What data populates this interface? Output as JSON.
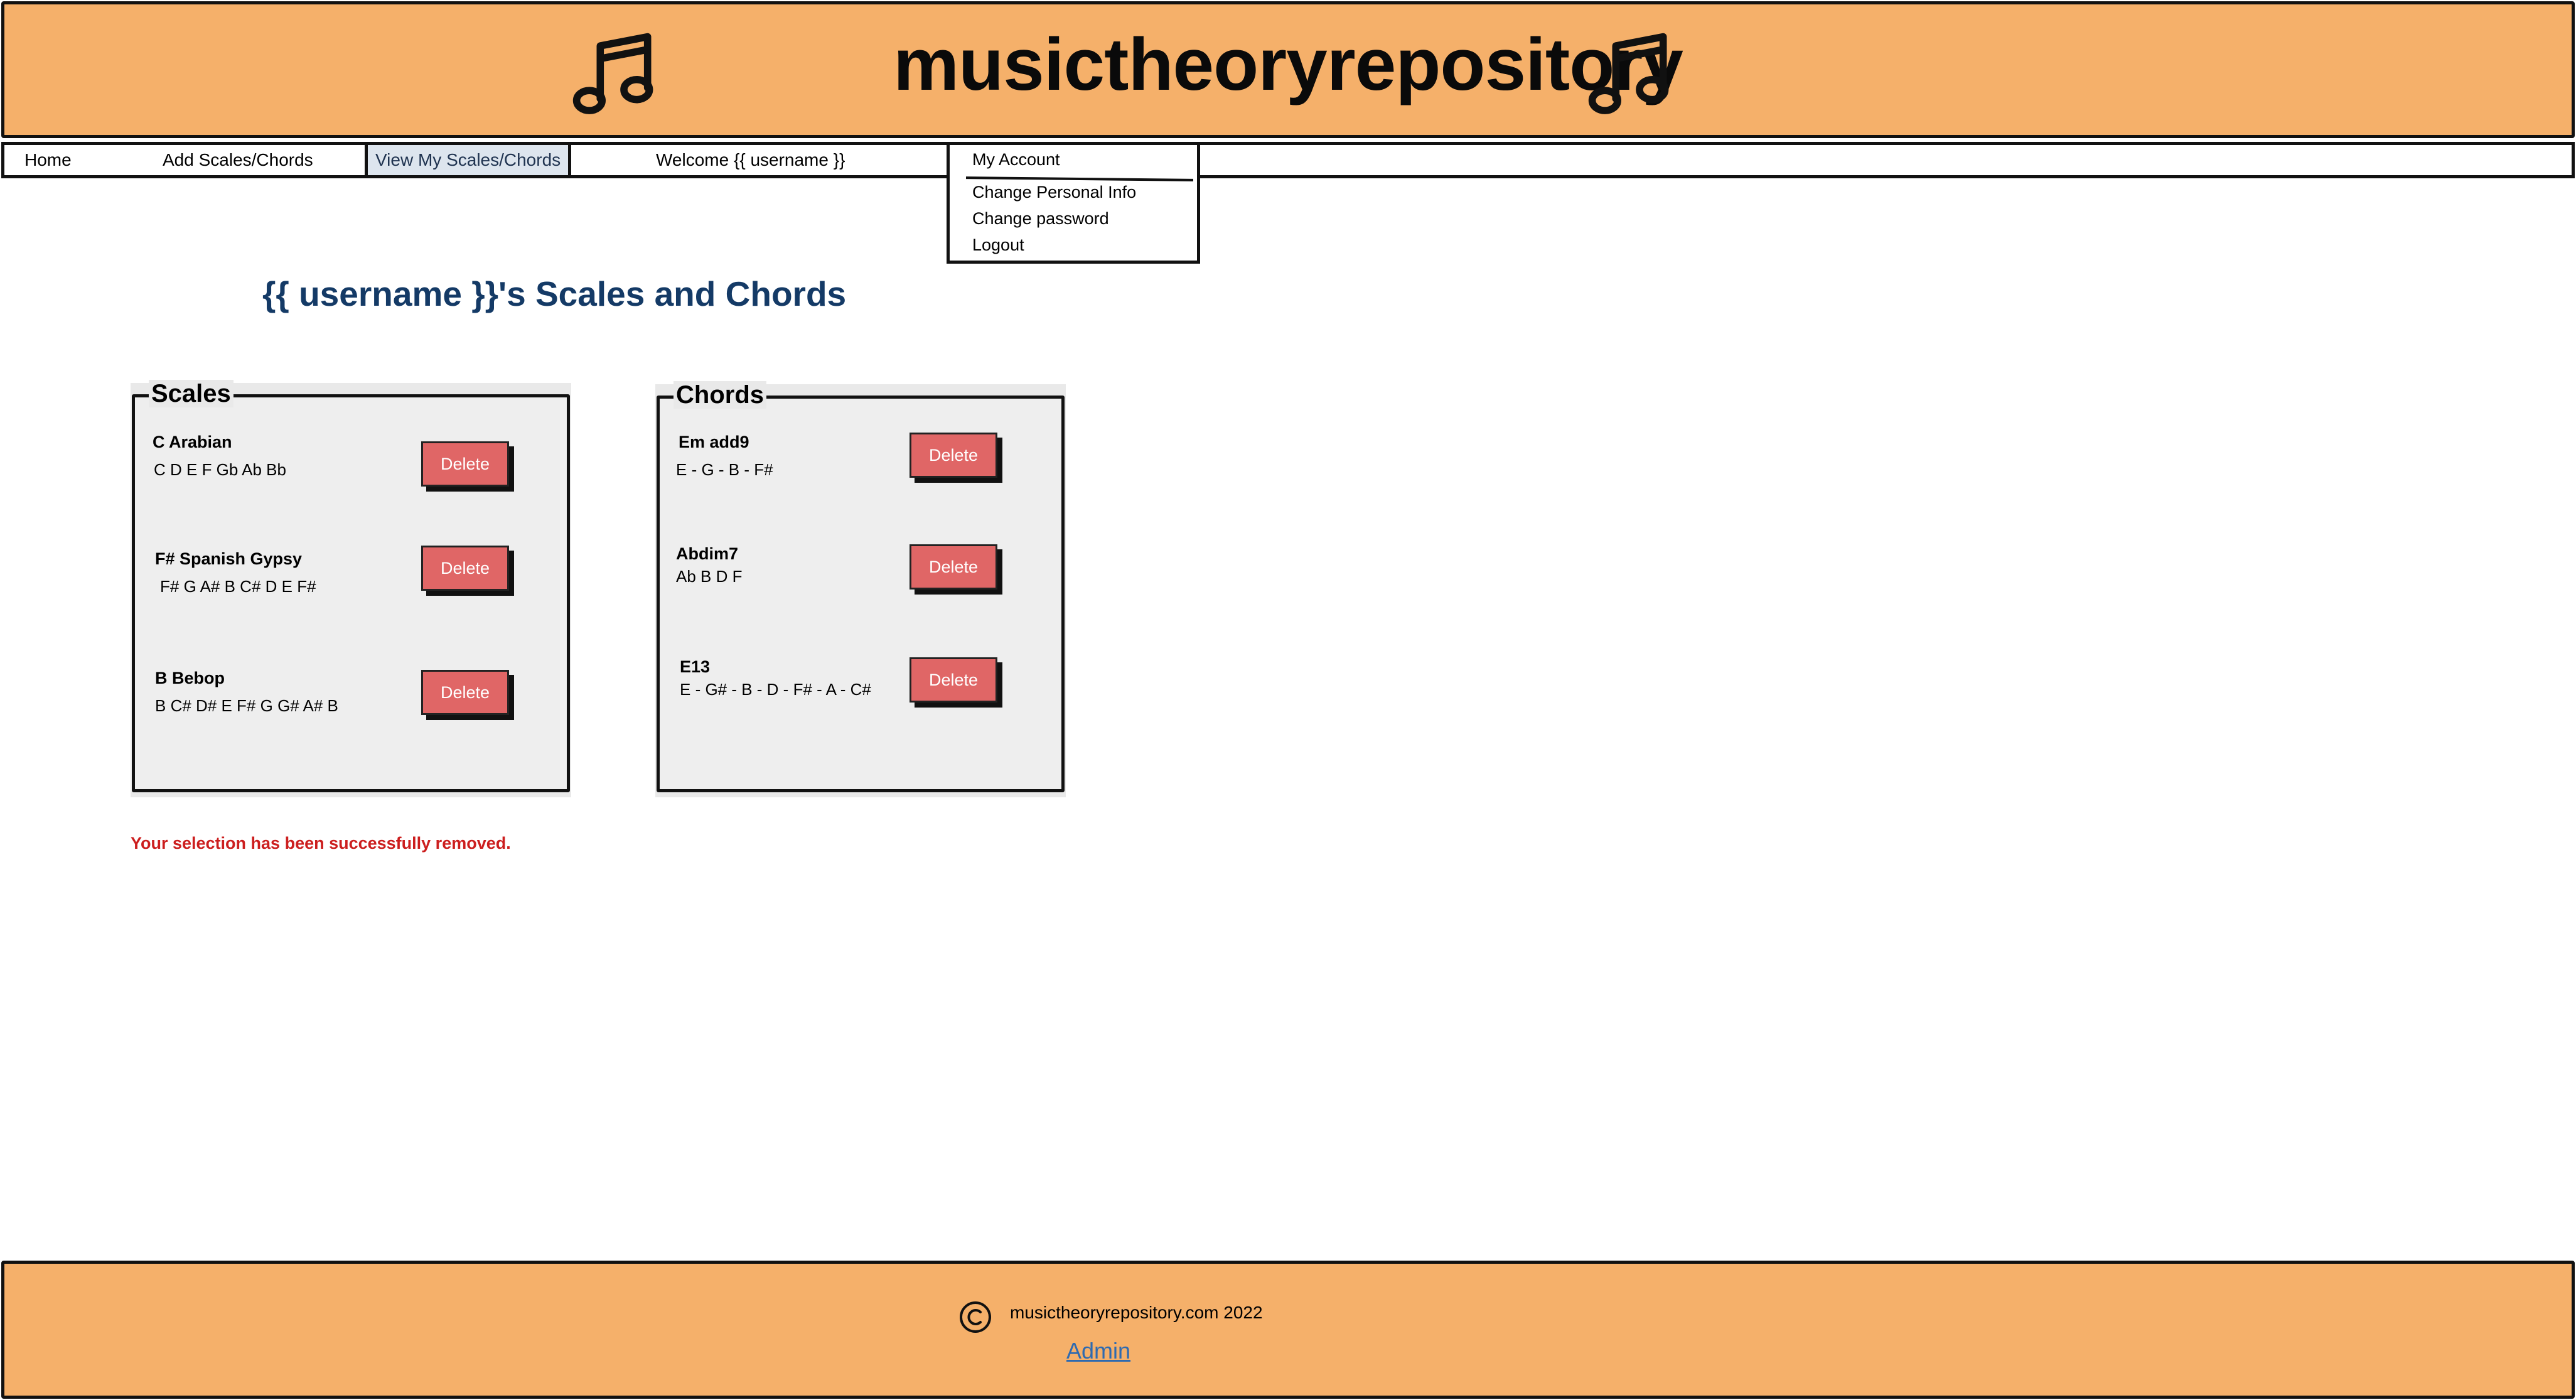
{
  "header": {
    "title": "musictheoryrepository",
    "icon_left": "music-note-icon",
    "icon_right": "music-note-icon",
    "bg_color": "#f5b06a"
  },
  "nav": {
    "items": [
      {
        "label": "Home"
      },
      {
        "label": "Add Scales/Chords"
      },
      {
        "label": "View My Scales/Chords",
        "active": true
      }
    ],
    "welcome": "Welcome {{ username }}"
  },
  "account_menu": {
    "title": "My Account",
    "items": [
      "Change Personal Info",
      "Change password",
      "Logout"
    ]
  },
  "main": {
    "title": "{{ username }}'s Scales and Chords",
    "scales": {
      "legend": "Scales",
      "items": [
        {
          "name": "C Arabian",
          "notes": "C D E F Gb Ab Bb",
          "button": "Delete"
        },
        {
          "name": "F# Spanish Gypsy",
          "notes": "F# G A# B C# D E F#",
          "button": "Delete"
        },
        {
          "name": "B Bebop",
          "notes": "B C# D# E F# G G# A# B",
          "button": "Delete"
        }
      ]
    },
    "chords": {
      "legend": "Chords",
      "items": [
        {
          "name": "Em add9",
          "notes": "E - G - B - F#",
          "button": "Delete"
        },
        {
          "name": "Abdim7",
          "notes": "Ab B D F",
          "button": "Delete"
        },
        {
          "name": "E13",
          "notes": "E - G# - B - D - F# - A - C#",
          "button": "Delete"
        }
      ]
    },
    "status_message": "Your selection has been successfully removed.",
    "status_color": "#cc1e1e",
    "delete_color": "#e06666"
  },
  "footer": {
    "copyright": "musictheoryrepository.com 2022",
    "copyright_icon": "copyright-icon",
    "admin_link": "Admin"
  }
}
